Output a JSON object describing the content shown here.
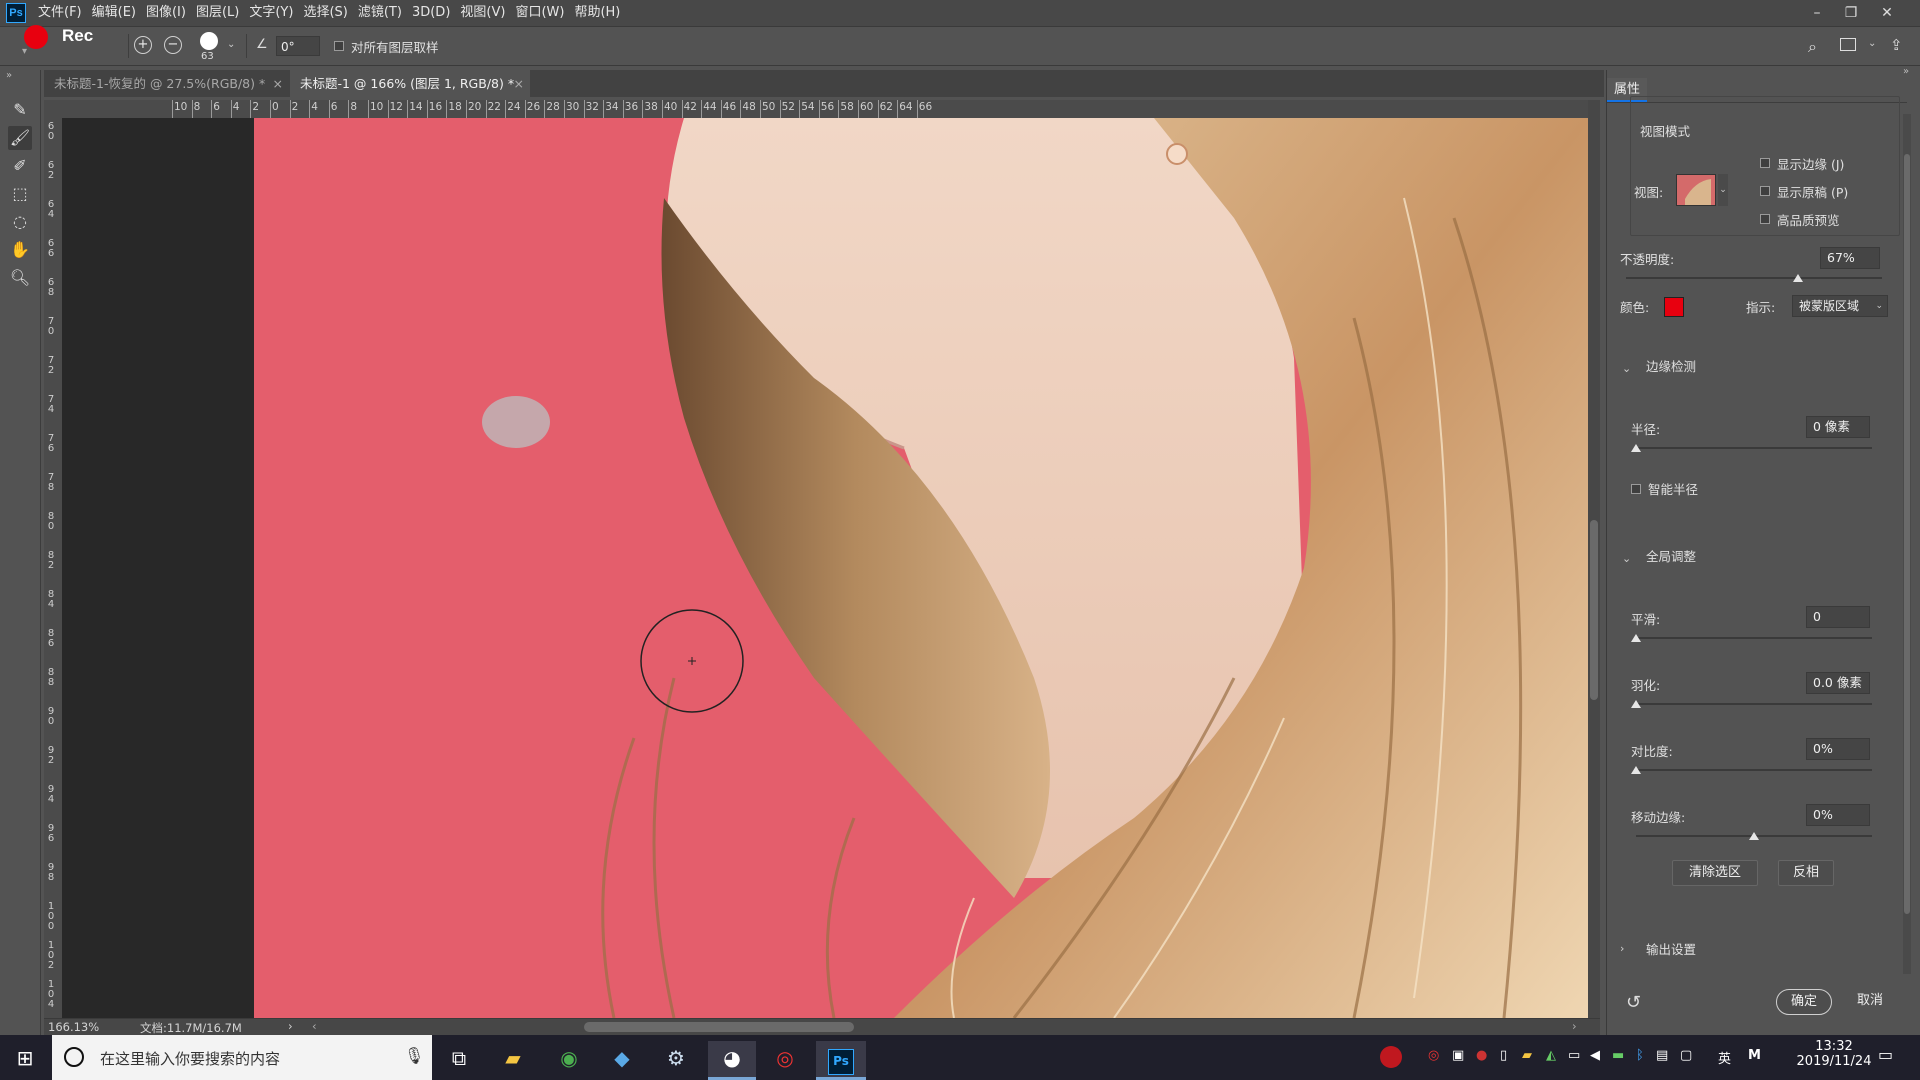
{
  "app": {
    "logo_text": "Ps",
    "menus": [
      "文件(F)",
      "编辑(E)",
      "图像(I)",
      "图层(L)",
      "文字(Y)",
      "选择(S)",
      "滤镜(T)",
      "3D(D)",
      "视图(V)",
      "窗口(W)",
      "帮助(H)"
    ],
    "window_controls": {
      "minimize": "–",
      "restore": "❐",
      "close": "✕"
    }
  },
  "options_bar": {
    "rec_label": "Rec",
    "brush_size": "63",
    "angle_value": "0°",
    "sample_all_layers_label": "对所有图层取样",
    "sample_all_layers_checked": false
  },
  "tabs": [
    {
      "label": "未标题-1-恢复的 @ 27.5%(RGB/8) *",
      "active": false
    },
    {
      "label": "未标题-1 @ 166% (图层 1, RGB/8) *",
      "active": true
    }
  ],
  "ruler": {
    "top_labels": [
      "10",
      "8",
      "6",
      "4",
      "2",
      "0",
      "2",
      "4",
      "6",
      "8",
      "10",
      "12",
      "14",
      "16",
      "18",
      "20",
      "22",
      "24",
      "26",
      "28",
      "30",
      "32",
      "34",
      "36",
      "38",
      "40",
      "42",
      "44",
      "46",
      "48",
      "50",
      "52",
      "54",
      "56",
      "58",
      "60",
      "62",
      "64",
      "66"
    ],
    "left_labels": [
      "60",
      "62",
      "64",
      "66",
      "68",
      "70",
      "72",
      "74",
      "76",
      "78",
      "80",
      "82",
      "84",
      "86",
      "88",
      "90",
      "92",
      "94",
      "96",
      "98",
      "100",
      "102",
      "104"
    ]
  },
  "status": {
    "zoom": "166.13%",
    "doc_info": "文档:11.7M/16.7M",
    "arrow": "›"
  },
  "properties": {
    "tab_label": "属性",
    "view_mode_title": "视图模式",
    "view_label": "视图:",
    "checkboxes": [
      {
        "label": "显示边缘 (J)",
        "checked": false
      },
      {
        "label": "显示原稿 (P)",
        "checked": false
      },
      {
        "label": "高品质预览",
        "checked": false
      }
    ],
    "opacity_label": "不透明度:",
    "opacity_value": "67%",
    "opacity_fraction": 0.67,
    "color_label": "颜色:",
    "overlay_color": "#e8000f",
    "indicate_label": "指示:",
    "indicate_value": "被蒙版区域",
    "edge_detection_title": "边缘检测",
    "radius_label": "半径:",
    "radius_value": "0 像素",
    "smart_radius_label": "智能半径",
    "global_refine_title": "全局调整",
    "smooth_label": "平滑:",
    "smooth_value": "0",
    "feather_label": "羽化:",
    "feather_value": "0.0 像素",
    "contrast_label": "对比度:",
    "contrast_value": "0%",
    "shift_edge_label": "移动边缘:",
    "shift_edge_value": "0%",
    "clear_selection_label": "清除选区",
    "invert_label": "反相",
    "output_settings_title": "输出设置",
    "ok_label": "确定",
    "cancel_label": "取消"
  },
  "taskbar": {
    "search_placeholder": "在这里输入你要搜索的内容",
    "time": "13:32",
    "date": "2019/11/24",
    "ime_label": "英",
    "ime_mode": "M"
  },
  "colors": {
    "ps_dark": "#535353",
    "accent_blue": "#1473e6",
    "mask_red": "#e45e6c"
  }
}
